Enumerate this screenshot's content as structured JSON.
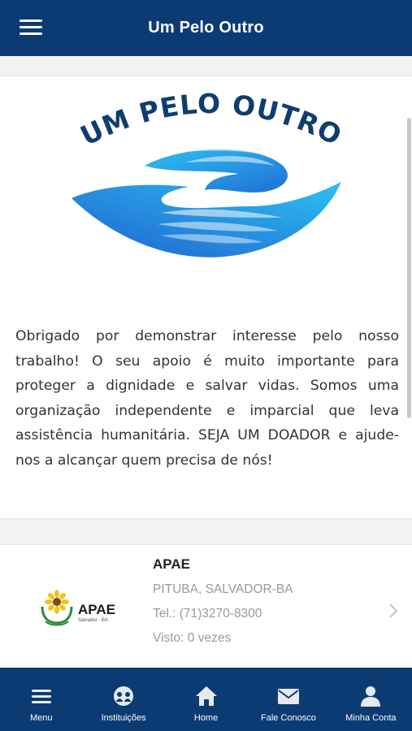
{
  "header": {
    "title": "Um Pelo Outro",
    "menu_icon": "hamburger-icon"
  },
  "logo": {
    "text": "UM PELO OUTRO",
    "colors": {
      "text": "#0f3d70",
      "hands_light": "#2fc0f2",
      "hands_dark": "#1f6fd6"
    }
  },
  "intro": {
    "line1": "Obrigado por demonstrar interesse pelo nosso",
    "rest": "trabalho! O seu apoio é muito importante para proteger a dignidade e salvar vidas. Somos uma organização independente e imparcial que leva assistência humanitária. SEJA UM DOADOR e ajude-nos a alcançar quem precisa de nós!"
  },
  "institution": {
    "name": "APAE",
    "address": "PITUBA, SALVADOR-BA",
    "phone": "Tel.: (71)3270-8300",
    "views": "Visto: 0 vezes",
    "logo_text": "APAE",
    "logo_subtext": "Salvador - BA"
  },
  "tabbar": {
    "items": [
      {
        "label": "Menu",
        "icon": "hamburger-icon"
      },
      {
        "label": "Instituições",
        "icon": "institutions-icon"
      },
      {
        "label": "Home",
        "icon": "home-icon"
      },
      {
        "label": "Fale Conosco",
        "icon": "envelope-icon"
      },
      {
        "label": "Minha Conta",
        "icon": "user-icon"
      }
    ]
  },
  "colors": {
    "primary": "#0c3b73",
    "text": "#333333",
    "muted": "#9a9a9a",
    "background": "#f2f2f2"
  }
}
